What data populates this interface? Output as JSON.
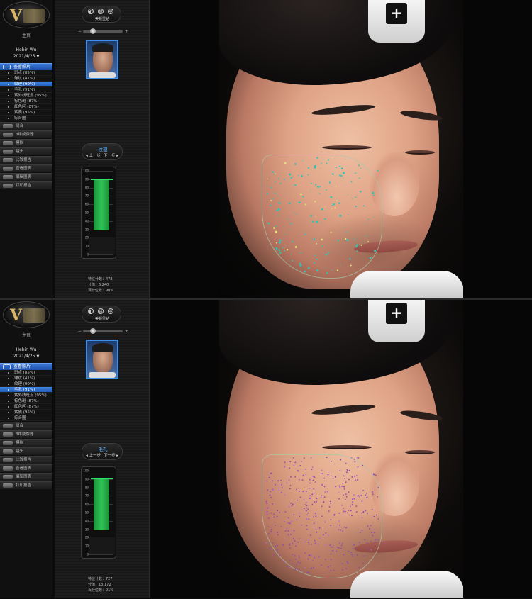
{
  "panels": [
    {
      "sidebar": {
        "logo_letter": "V",
        "home": "主页",
        "user": "Hebin Wu",
        "date": "2021/4/25",
        "section_head": "查看照片",
        "items": [
          {
            "label": "斑点 (85%)",
            "active": false
          },
          {
            "label": "皱纹 (41%)",
            "active": false
          },
          {
            "label": "纹理 (90%)",
            "active": true
          },
          {
            "label": "毛孔 (91%)",
            "active": false
          },
          {
            "label": "紫外线斑点 (95%)",
            "active": false
          },
          {
            "label": "棕色斑 (87%)",
            "active": false
          },
          {
            "label": "红色区 (87%)",
            "active": false
          },
          {
            "label": "紫质 (95%)",
            "active": false
          },
          {
            "label": "综合图",
            "active": false
          }
        ],
        "tools": [
          "缝合",
          "3维成像器",
          "模拟",
          "镜头",
          "比较报告",
          "查看图表",
          "编辑图表",
          "打印报告"
        ]
      },
      "middle": {
        "iconbar_caption": "美颜重钻",
        "slider_left": "−",
        "slider_right": "+",
        "metric_title": "纹理",
        "prev": "上一步",
        "next": "下一步",
        "stats": [
          "特征计数：478",
          "分值：6.240",
          "百分位数：90%"
        ]
      },
      "chart_data": {
        "type": "bar",
        "ylim": [
          0,
          100
        ],
        "yticks": [
          "100",
          "90",
          "80",
          "70",
          "60",
          "50",
          "40",
          "30",
          "20",
          "10",
          "0"
        ],
        "values": [
          90
        ],
        "color": "#2fc456"
      },
      "overlay": {
        "color": "#35c2b5",
        "accent": "#e3e07a",
        "count": 180
      }
    },
    {
      "sidebar": {
        "logo_letter": "V",
        "home": "主页",
        "user": "Hebin Wu",
        "date": "2021/4/25",
        "section_head": "查看照片",
        "items": [
          {
            "label": "斑点 (85%)",
            "active": false
          },
          {
            "label": "皱纹 (41%)",
            "active": false
          },
          {
            "label": "纹理 (90%)",
            "active": false
          },
          {
            "label": "毛孔 (91%)",
            "active": true
          },
          {
            "label": "紫外线斑点 (95%)",
            "active": false
          },
          {
            "label": "棕色斑 (87%)",
            "active": false
          },
          {
            "label": "红色区 (87%)",
            "active": false
          },
          {
            "label": "紫质 (95%)",
            "active": false
          },
          {
            "label": "综合图",
            "active": false
          }
        ],
        "tools": [
          "缝合",
          "3维成像器",
          "模拟",
          "镜头",
          "比较报告",
          "查看图表",
          "编辑图表",
          "打印报告"
        ]
      },
      "middle": {
        "iconbar_caption": "美颜重钻",
        "slider_left": "−",
        "slider_right": "+",
        "metric_title": "毛孔",
        "prev": "上一步",
        "next": "下一步",
        "stats": [
          "特征计数：727",
          "分值：13.172",
          "百分位数：91%"
        ]
      },
      "chart_data": {
        "type": "bar",
        "ylim": [
          0,
          100
        ],
        "yticks": [
          "100",
          "90",
          "80",
          "70",
          "60",
          "50",
          "40",
          "30",
          "20",
          "10",
          "0"
        ],
        "values": [
          91
        ],
        "color": "#2fc456"
      },
      "overlay": {
        "color": "#8a4bb0",
        "accent": "#b06ad0",
        "count": 420
      }
    }
  ]
}
